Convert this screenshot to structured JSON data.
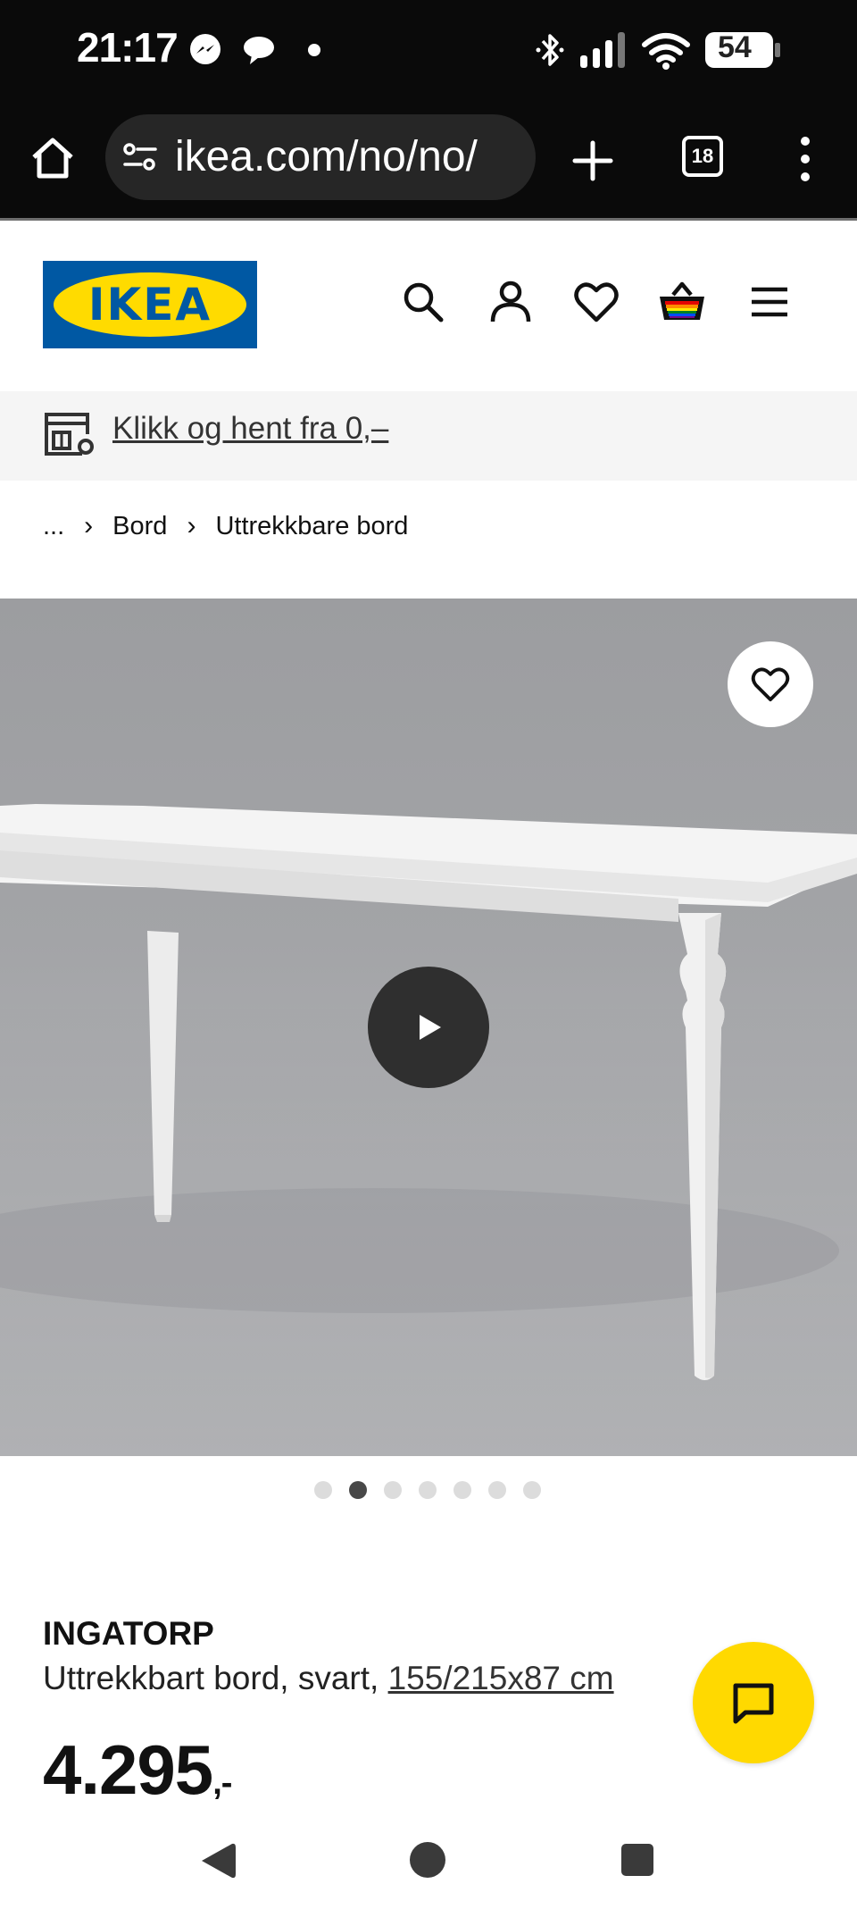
{
  "status_bar": {
    "time": "21:17",
    "battery": "54",
    "icons": [
      "messenger-icon",
      "chat-bubble-icon",
      "dot-icon",
      "bluetooth-icon",
      "signal-icon",
      "wifi-icon",
      "battery-icon"
    ]
  },
  "browser": {
    "url": "ikea.com/no/no/",
    "tab_count": "18",
    "icons": [
      "home-icon",
      "site-settings-icon",
      "new-tab-icon",
      "tabs-icon",
      "more-menu-icon"
    ]
  },
  "header": {
    "logo_text": "IKEA",
    "icons": [
      "search-icon",
      "account-icon",
      "heart-icon",
      "basket-icon",
      "menu-icon"
    ]
  },
  "banner": {
    "text": "Klikk og hent fra 0,–",
    "icon": "store-icon"
  },
  "breadcrumb": {
    "items": [
      "...",
      "Bord",
      "Uttrekkbare bord"
    ]
  },
  "gallery": {
    "slide_count": 7,
    "active_index": 1,
    "icons": [
      "favourite-heart-icon",
      "play-icon"
    ]
  },
  "product": {
    "name": "INGATORP",
    "description": "Uttrekkbart bord, svart, ",
    "dimensions": "155/215x87 cm",
    "price": "4.295",
    "price_suffix": ",-"
  },
  "colors": {
    "ikea_blue": "#0058a3",
    "ikea_yellow": "#ffdb00",
    "chat_yellow": "#ffd900"
  },
  "chat": {
    "icon": "chat-icon"
  },
  "nav": {
    "icons": [
      "back-icon",
      "home-circle-icon",
      "recents-icon"
    ]
  }
}
